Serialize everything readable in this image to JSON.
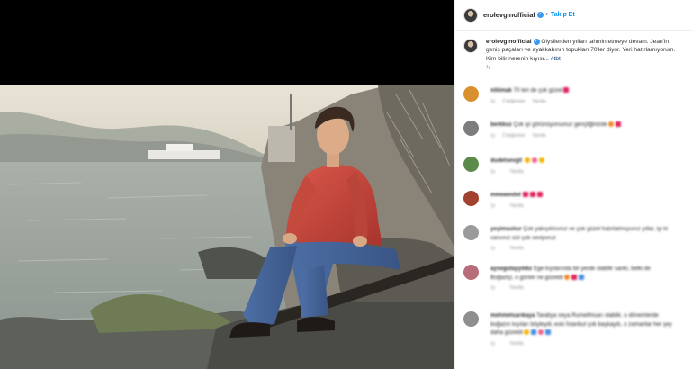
{
  "post": {
    "username": "erolevginofficial",
    "verified_symbol": "✓",
    "separator": "•",
    "follow_label": "Takip Et",
    "caption_text": "Giysilerden yılları tahmin etmeye devam. Jean'in geniş paçaları ve ayakkabının topukları 70'ler diyor. Yeri hatırlamıyorum. Kim bilir nerenin kıyısı...",
    "hashtag": "#tbt",
    "caption_time": "1y"
  },
  "comments": [
    {
      "user": "nilümak",
      "text": "70 leri de çok güzel",
      "time": "1y",
      "likes": "2 beğenme",
      "reply": "Yanıtla",
      "avatar_color": "#d9902f",
      "emojis": [
        "red"
      ]
    },
    {
      "user": "berkkuz",
      "text": "Çok iyi görünüyorsunuz gençliğinizde",
      "time": "1y",
      "likes": "2 beğenme",
      "reply": "Yanıtla",
      "avatar_color": "#7d7d7d",
      "emojis": [
        "orange",
        "red"
      ]
    },
    {
      "user": "dudetsevgil",
      "text": "",
      "time": "1y",
      "likes": "",
      "reply": "Yanıtla",
      "avatar_color": "#5b8a4a",
      "emojis": [
        "yellow",
        "pink",
        "yellow"
      ]
    },
    {
      "user": "mewawsbd",
      "text": "",
      "time": "1y",
      "likes": "",
      "reply": "Yanıtla",
      "avatar_color": "#a3412f",
      "emojis": [
        "red",
        "red",
        "red"
      ]
    },
    {
      "user": "yeşimaslıur",
      "text": "Çok yakışıklısınız ve çok güzel hatırlatmışsınız yıllar, iyi ki varsınız sizi çok seviyoruz",
      "time": "1y",
      "likes": "",
      "reply": "Yanıtla",
      "avatar_color": "#9a9a9a",
      "emojis": []
    },
    {
      "user": "aysegulayyıldız",
      "text": "Ege kıyılarında bir yerde olabilir sanki, belki de Boğaziçi, o günler ne güzeldi",
      "time": "1y",
      "likes": "",
      "reply": "Yanıtla",
      "avatar_color": "#b86d7a",
      "emojis": [
        "orange",
        "red",
        "blue"
      ]
    },
    {
      "user": "mehmetsarıkaya",
      "text": "Tarabya veya Rumelihisarı olabilir, o dönemlerde boğazın kıyıları böyleydi, eski İstanbul çok başkaydı, o zamanlar her şey daha güzeldi",
      "time": "1y",
      "likes": "",
      "reply": "Yanıtla",
      "avatar_color": "#8f8f8f",
      "emojis": [
        "yellow",
        "blue",
        "pink",
        "blue"
      ]
    }
  ],
  "colors": {
    "accent": "#0095f6",
    "verified": "#3897f0",
    "text": "#262626",
    "muted": "#8e8e8e"
  },
  "icons": {
    "verified": "verified-badge-icon"
  }
}
